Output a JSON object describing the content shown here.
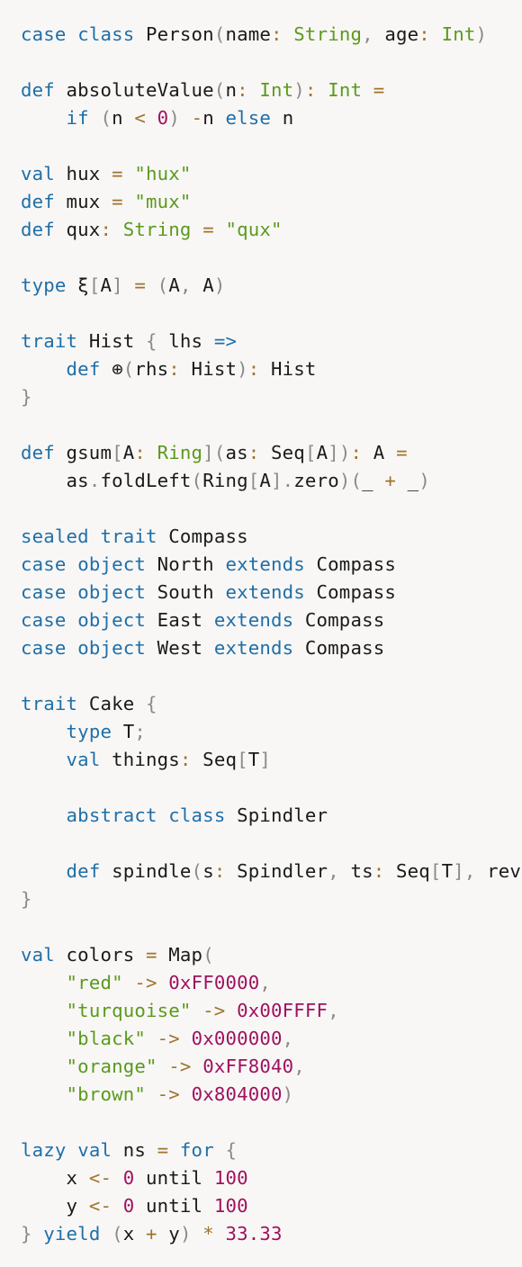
{
  "colors": {
    "background": "#f8f7f6",
    "keyword": "#1f6fa8",
    "type": "#5b9a1c",
    "string": "#5b9a1c",
    "number": "#a0115f",
    "operator": "#a0732a",
    "punctuation": "#8a8a8a",
    "plain": "#1a1a1a"
  },
  "lines": [
    [
      [
        "kw",
        "case"
      ],
      [
        "plain",
        " "
      ],
      [
        "kw",
        "class"
      ],
      [
        "plain",
        " Person"
      ],
      [
        "punc",
        "("
      ],
      [
        "plain",
        "name"
      ],
      [
        "op",
        ":"
      ],
      [
        "plain",
        " "
      ],
      [
        "type",
        "String"
      ],
      [
        "punc",
        ","
      ],
      [
        "plain",
        " age"
      ],
      [
        "op",
        ":"
      ],
      [
        "plain",
        " "
      ],
      [
        "type",
        "Int"
      ],
      [
        "punc",
        ")"
      ]
    ],
    [],
    [
      [
        "kw",
        "def"
      ],
      [
        "plain",
        " absoluteValue"
      ],
      [
        "punc",
        "("
      ],
      [
        "plain",
        "n"
      ],
      [
        "op",
        ":"
      ],
      [
        "plain",
        " "
      ],
      [
        "type",
        "Int"
      ],
      [
        "punc",
        ")"
      ],
      [
        "op",
        ":"
      ],
      [
        "plain",
        " "
      ],
      [
        "type",
        "Int"
      ],
      [
        "plain",
        " "
      ],
      [
        "op",
        "="
      ]
    ],
    [
      [
        "plain",
        "    "
      ],
      [
        "kw",
        "if"
      ],
      [
        "plain",
        " "
      ],
      [
        "punc",
        "("
      ],
      [
        "plain",
        "n "
      ],
      [
        "op",
        "<"
      ],
      [
        "plain",
        " "
      ],
      [
        "num",
        "0"
      ],
      [
        "punc",
        ")"
      ],
      [
        "plain",
        " "
      ],
      [
        "op",
        "-"
      ],
      [
        "plain",
        "n "
      ],
      [
        "kw",
        "else"
      ],
      [
        "plain",
        " n"
      ]
    ],
    [],
    [
      [
        "kw",
        "val"
      ],
      [
        "plain",
        " hux "
      ],
      [
        "op",
        "="
      ],
      [
        "plain",
        " "
      ],
      [
        "str",
        "\"hux\""
      ]
    ],
    [
      [
        "kw",
        "def"
      ],
      [
        "plain",
        " mux "
      ],
      [
        "op",
        "="
      ],
      [
        "plain",
        " "
      ],
      [
        "str",
        "\"mux\""
      ]
    ],
    [
      [
        "kw",
        "def"
      ],
      [
        "plain",
        " qux"
      ],
      [
        "op",
        ":"
      ],
      [
        "plain",
        " "
      ],
      [
        "type",
        "String"
      ],
      [
        "plain",
        " "
      ],
      [
        "op",
        "="
      ],
      [
        "plain",
        " "
      ],
      [
        "str",
        "\"qux\""
      ]
    ],
    [],
    [
      [
        "kw",
        "type"
      ],
      [
        "plain",
        " ξ"
      ],
      [
        "punc",
        "["
      ],
      [
        "plain",
        "A"
      ],
      [
        "punc",
        "]"
      ],
      [
        "plain",
        " "
      ],
      [
        "op",
        "="
      ],
      [
        "plain",
        " "
      ],
      [
        "punc",
        "("
      ],
      [
        "plain",
        "A"
      ],
      [
        "punc",
        ","
      ],
      [
        "plain",
        " A"
      ],
      [
        "punc",
        ")"
      ]
    ],
    [],
    [
      [
        "kw",
        "trait"
      ],
      [
        "plain",
        " Hist "
      ],
      [
        "punc",
        "{"
      ],
      [
        "plain",
        " lhs "
      ],
      [
        "kw",
        "=>"
      ]
    ],
    [
      [
        "plain",
        "    "
      ],
      [
        "kw",
        "def"
      ],
      [
        "plain",
        " ⊕"
      ],
      [
        "punc",
        "("
      ],
      [
        "plain",
        "rhs"
      ],
      [
        "op",
        ":"
      ],
      [
        "plain",
        " Hist"
      ],
      [
        "punc",
        ")"
      ],
      [
        "op",
        ":"
      ],
      [
        "plain",
        " Hist"
      ]
    ],
    [
      [
        "punc",
        "}"
      ]
    ],
    [],
    [
      [
        "kw",
        "def"
      ],
      [
        "plain",
        " gsum"
      ],
      [
        "punc",
        "["
      ],
      [
        "plain",
        "A"
      ],
      [
        "op",
        ":"
      ],
      [
        "plain",
        " "
      ],
      [
        "type",
        "Ring"
      ],
      [
        "punc",
        "]("
      ],
      [
        "plain",
        "as"
      ],
      [
        "op",
        ":"
      ],
      [
        "plain",
        " Seq"
      ],
      [
        "punc",
        "["
      ],
      [
        "plain",
        "A"
      ],
      [
        "punc",
        "])"
      ],
      [
        "op",
        ":"
      ],
      [
        "plain",
        " A "
      ],
      [
        "op",
        "="
      ]
    ],
    [
      [
        "plain",
        "    as"
      ],
      [
        "punc",
        "."
      ],
      [
        "plain",
        "foldLeft"
      ],
      [
        "punc",
        "("
      ],
      [
        "plain",
        "Ring"
      ],
      [
        "punc",
        "["
      ],
      [
        "plain",
        "A"
      ],
      [
        "punc",
        "]."
      ],
      [
        "plain",
        "zero"
      ],
      [
        "punc",
        ")("
      ],
      [
        "plain",
        "_ "
      ],
      [
        "op",
        "+"
      ],
      [
        "plain",
        " _"
      ],
      [
        "punc",
        ")"
      ]
    ],
    [],
    [
      [
        "kw",
        "sealed"
      ],
      [
        "plain",
        " "
      ],
      [
        "kw",
        "trait"
      ],
      [
        "plain",
        " Compass"
      ]
    ],
    [
      [
        "kw",
        "case"
      ],
      [
        "plain",
        " "
      ],
      [
        "kw",
        "object"
      ],
      [
        "plain",
        " North "
      ],
      [
        "kw",
        "extends"
      ],
      [
        "plain",
        " Compass"
      ]
    ],
    [
      [
        "kw",
        "case"
      ],
      [
        "plain",
        " "
      ],
      [
        "kw",
        "object"
      ],
      [
        "plain",
        " South "
      ],
      [
        "kw",
        "extends"
      ],
      [
        "plain",
        " Compass"
      ]
    ],
    [
      [
        "kw",
        "case"
      ],
      [
        "plain",
        " "
      ],
      [
        "kw",
        "object"
      ],
      [
        "plain",
        " East "
      ],
      [
        "kw",
        "extends"
      ],
      [
        "plain",
        " Compass"
      ]
    ],
    [
      [
        "kw",
        "case"
      ],
      [
        "plain",
        " "
      ],
      [
        "kw",
        "object"
      ],
      [
        "plain",
        " West "
      ],
      [
        "kw",
        "extends"
      ],
      [
        "plain",
        " Compass"
      ]
    ],
    [],
    [
      [
        "kw",
        "trait"
      ],
      [
        "plain",
        " Cake "
      ],
      [
        "punc",
        "{"
      ]
    ],
    [
      [
        "plain",
        "    "
      ],
      [
        "kw",
        "type"
      ],
      [
        "plain",
        " T"
      ],
      [
        "punc",
        ";"
      ]
    ],
    [
      [
        "plain",
        "    "
      ],
      [
        "kw",
        "val"
      ],
      [
        "plain",
        " things"
      ],
      [
        "op",
        ":"
      ],
      [
        "plain",
        " Seq"
      ],
      [
        "punc",
        "["
      ],
      [
        "plain",
        "T"
      ],
      [
        "punc",
        "]"
      ]
    ],
    [],
    [
      [
        "plain",
        "    "
      ],
      [
        "kw",
        "abstract"
      ],
      [
        "plain",
        " "
      ],
      [
        "kw",
        "class"
      ],
      [
        "plain",
        " Spindler"
      ]
    ],
    [],
    [
      [
        "plain",
        "    "
      ],
      [
        "kw",
        "def"
      ],
      [
        "plain",
        " spindle"
      ],
      [
        "punc",
        "("
      ],
      [
        "plain",
        "s"
      ],
      [
        "op",
        ":"
      ],
      [
        "plain",
        " Spindler"
      ],
      [
        "punc",
        ","
      ],
      [
        "plain",
        " ts"
      ],
      [
        "op",
        ":"
      ],
      [
        "plain",
        " Seq"
      ],
      [
        "punc",
        "["
      ],
      [
        "plain",
        "T"
      ],
      [
        "punc",
        "],"
      ],
      [
        "plain",
        " reve"
      ]
    ],
    [
      [
        "punc",
        "}"
      ]
    ],
    [],
    [
      [
        "kw",
        "val"
      ],
      [
        "plain",
        " colors "
      ],
      [
        "op",
        "="
      ],
      [
        "plain",
        " Map"
      ],
      [
        "punc",
        "("
      ]
    ],
    [
      [
        "plain",
        "    "
      ],
      [
        "str",
        "\"red\""
      ],
      [
        "plain",
        " "
      ],
      [
        "op",
        "->"
      ],
      [
        "plain",
        " "
      ],
      [
        "num",
        "0xFF0000"
      ],
      [
        "punc",
        ","
      ]
    ],
    [
      [
        "plain",
        "    "
      ],
      [
        "str",
        "\"turquoise\""
      ],
      [
        "plain",
        " "
      ],
      [
        "op",
        "->"
      ],
      [
        "plain",
        " "
      ],
      [
        "num",
        "0x00FFFF"
      ],
      [
        "punc",
        ","
      ]
    ],
    [
      [
        "plain",
        "    "
      ],
      [
        "str",
        "\"black\""
      ],
      [
        "plain",
        " "
      ],
      [
        "op",
        "->"
      ],
      [
        "plain",
        " "
      ],
      [
        "num",
        "0x000000"
      ],
      [
        "punc",
        ","
      ]
    ],
    [
      [
        "plain",
        "    "
      ],
      [
        "str",
        "\"orange\""
      ],
      [
        "plain",
        " "
      ],
      [
        "op",
        "->"
      ],
      [
        "plain",
        " "
      ],
      [
        "num",
        "0xFF8040"
      ],
      [
        "punc",
        ","
      ]
    ],
    [
      [
        "plain",
        "    "
      ],
      [
        "str",
        "\"brown\""
      ],
      [
        "plain",
        " "
      ],
      [
        "op",
        "->"
      ],
      [
        "plain",
        " "
      ],
      [
        "num",
        "0x804000"
      ],
      [
        "punc",
        ")"
      ]
    ],
    [],
    [
      [
        "kw",
        "lazy"
      ],
      [
        "plain",
        " "
      ],
      [
        "kw",
        "val"
      ],
      [
        "plain",
        " ns "
      ],
      [
        "op",
        "="
      ],
      [
        "plain",
        " "
      ],
      [
        "kw",
        "for"
      ],
      [
        "plain",
        " "
      ],
      [
        "punc",
        "{"
      ]
    ],
    [
      [
        "plain",
        "    x "
      ],
      [
        "op",
        "<-"
      ],
      [
        "plain",
        " "
      ],
      [
        "num",
        "0"
      ],
      [
        "plain",
        " until "
      ],
      [
        "num",
        "100"
      ]
    ],
    [
      [
        "plain",
        "    y "
      ],
      [
        "op",
        "<-"
      ],
      [
        "plain",
        " "
      ],
      [
        "num",
        "0"
      ],
      [
        "plain",
        " until "
      ],
      [
        "num",
        "100"
      ]
    ],
    [
      [
        "punc",
        "}"
      ],
      [
        "plain",
        " "
      ],
      [
        "kw",
        "yield"
      ],
      [
        "plain",
        " "
      ],
      [
        "punc",
        "("
      ],
      [
        "plain",
        "x "
      ],
      [
        "op",
        "+"
      ],
      [
        "plain",
        " y"
      ],
      [
        "punc",
        ")"
      ],
      [
        "plain",
        " "
      ],
      [
        "op",
        "*"
      ],
      [
        "plain",
        " "
      ],
      [
        "num",
        "33.33"
      ]
    ]
  ]
}
